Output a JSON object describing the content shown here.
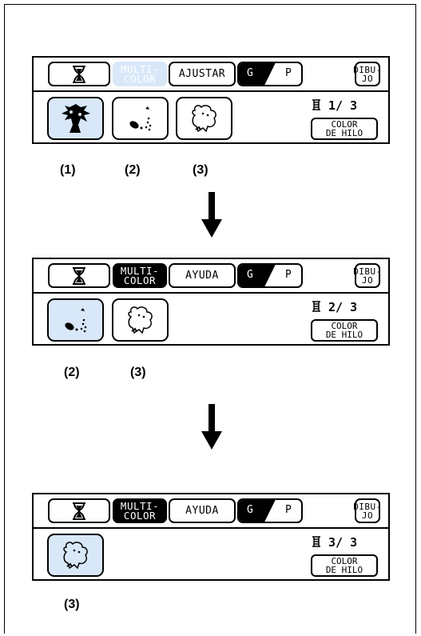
{
  "icons": {
    "hourglass": "hourglass-icon",
    "thread_spool": "thread-spool-icon",
    "arrow": "arrow-down-icon",
    "pattern1": "tree-embroidery-icon",
    "pattern2": "dots-embroidery-icon",
    "pattern3": "animal-embroidery-icon"
  },
  "colors": {
    "selected_bg": "#d8e8f8",
    "faded_button": "#d8e8f8",
    "text": "#000000"
  },
  "screens": [
    {
      "multicolor_line1": "MULTI-",
      "multicolor_line2": "COLOR",
      "multicolor_state": "faded",
      "middle_button": "AJUSTAR",
      "g_label": "G",
      "p_label": "P",
      "dibujo_line1": "DIBU-",
      "dibujo_line2": "JO",
      "counter": "1/ 3",
      "color_btn_line1": "COLOR",
      "color_btn_line2": "DE HILO",
      "patterns": [
        "(1)",
        "(2)",
        "(3)"
      ],
      "selected_pattern": "(1)"
    },
    {
      "multicolor_line1": "MULTI-",
      "multicolor_line2": "COLOR",
      "multicolor_state": "active",
      "middle_button": "AYUDA",
      "g_label": "G",
      "p_label": "P",
      "dibujo_line1": "DIBU-",
      "dibujo_line2": "JO",
      "counter": "2/ 3",
      "color_btn_line1": "COLOR",
      "color_btn_line2": "DE HILO",
      "patterns": [
        "(2)",
        "(3)"
      ],
      "selected_pattern": "(2)"
    },
    {
      "multicolor_line1": "MULTI-",
      "multicolor_line2": "COLOR",
      "multicolor_state": "active",
      "middle_button": "AYUDA",
      "g_label": "G",
      "p_label": "P",
      "dibujo_line1": "DIBU-",
      "dibujo_line2": "JO",
      "counter": "3/ 3",
      "color_btn_line1": "COLOR",
      "color_btn_line2": "DE HILO",
      "patterns": [
        "(3)"
      ],
      "selected_pattern": "(3)"
    }
  ]
}
